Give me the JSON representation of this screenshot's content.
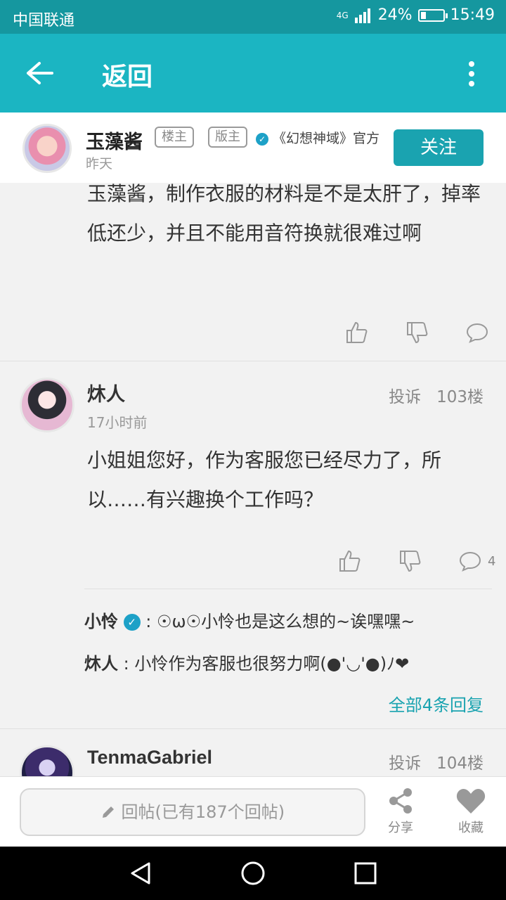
{
  "status_bar": {
    "carrier": "中国联通",
    "battery": "24%",
    "battery_fraction": 0.24,
    "time": "15:49",
    "network": "4G"
  },
  "header": {
    "title": "返回"
  },
  "op": {
    "name": "玉藻酱",
    "tag_louzhu": "楼主",
    "tag_banzhu": "版主",
    "official": "《幻想神域》官方",
    "time": "昨天",
    "follow_label": "关注"
  },
  "post1": {
    "text": "玉藻酱，制作衣服的材料是不是太肝了，掉率低还少，并且不能用音符换就很难过啊"
  },
  "post2": {
    "user": "炑人",
    "since": "17小时前",
    "report": "投诉",
    "floor": "103楼",
    "text": "小姐姐您好，作为客服您已经尽力了，所以……有兴趣换个工作吗？",
    "comment_count": "4",
    "replies": [
      {
        "user": "小怜",
        "text": " : ☉ω☉小怜也是这么想的~诶嘿嘿~"
      },
      {
        "user": "炑人",
        "text": " : 小怜作为客服也很努力啊(●'◡'●)ﾉ❤"
      }
    ],
    "all_replies": "全部4条回复"
  },
  "post3": {
    "user": "TenmaGabriel",
    "report": "投诉",
    "floor": "104楼"
  },
  "bottom": {
    "reply_placeholder": "回帖(已有187个回帖)",
    "share": "分享",
    "favorite": "收藏"
  },
  "colors": {
    "status": "#15979f",
    "header": "#1bb5c2",
    "accent": "#1aa3b0"
  },
  "icons": [
    "back-arrow-icon",
    "more-icon",
    "verified-icon",
    "thumb-up-icon",
    "thumb-down-icon",
    "comment-icon",
    "pencil-icon",
    "share-icon",
    "heart-icon"
  ]
}
